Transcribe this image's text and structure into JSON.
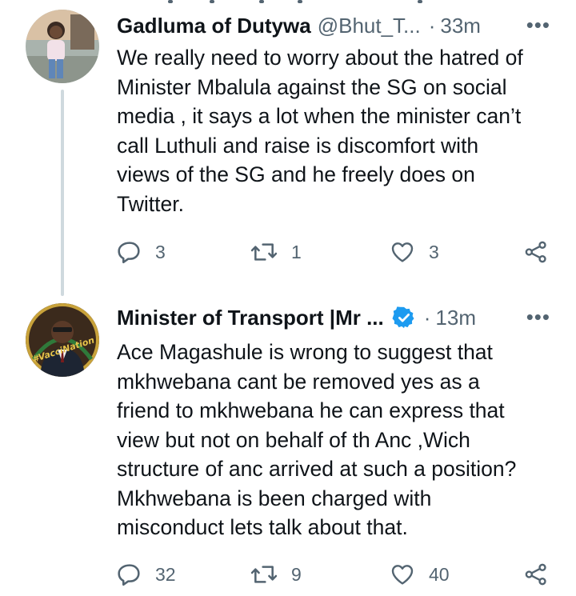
{
  "tweets": [
    {
      "display_name": "Gadluma of Dutywa",
      "handle": "@Bhut_T...",
      "separator": "·",
      "time": "33m",
      "more": "•••",
      "lines": [
        "We really need to worry about the hatred of",
        "Minister Mbalula against the SG on social",
        "media , it says a lot when the minister can’t",
        "call Luthuli and raise is discomfort with",
        "views of the SG and he freely does on",
        "Twitter."
      ],
      "replies": "3",
      "retweets": "1",
      "likes": "3"
    },
    {
      "display_name": "Minister of Transport |Mr ...",
      "verified": true,
      "separator": "·",
      "time": "13m",
      "more": "•••",
      "avatar_text": "#VacciNation",
      "lines": [
        "Ace Magashule is wrong to suggest that",
        "mkhwebana cant be removed yes as a",
        "friend to mkhwebana he can express that",
        "view but not on behalf of th Anc ,Wich",
        "structure of anc arrived at such a position?",
        "Mkhwebana is been charged with",
        "misconduct lets talk about that."
      ],
      "replies": "32",
      "retweets": "9",
      "likes": "40"
    }
  ],
  "icons": {
    "reply": "reply-icon",
    "retweet": "retweet-icon",
    "like": "like-icon",
    "share": "share-icon",
    "verified": "verified-badge-icon"
  },
  "colors": {
    "text": "#0f1419",
    "secondary": "#536471",
    "verified": "#1d9bf0",
    "thread_line": "#cfd9de"
  }
}
